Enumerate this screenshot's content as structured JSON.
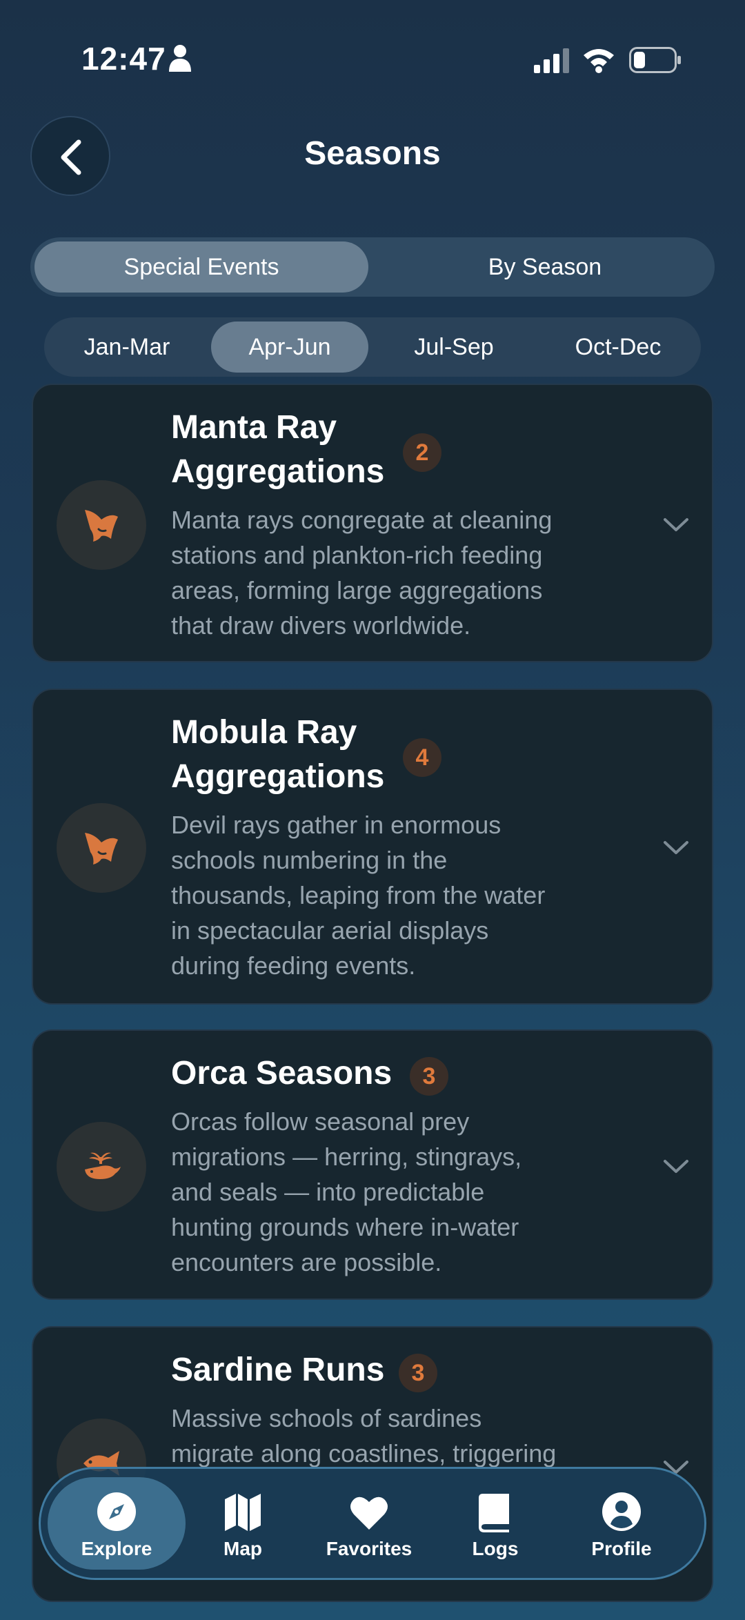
{
  "status_bar": {
    "time": "12:47"
  },
  "header": {
    "title": "Seasons"
  },
  "segments": [
    {
      "label": "Special Events",
      "active": true
    },
    {
      "label": "By Season",
      "active": false
    }
  ],
  "quarters": [
    {
      "label": "Jan-Mar",
      "active": false
    },
    {
      "label": "Apr-Jun",
      "active": true
    },
    {
      "label": "Jul-Sep",
      "active": false
    },
    {
      "label": "Oct-Dec",
      "active": false
    }
  ],
  "events": [
    {
      "title_lines": [
        "Manta Ray",
        "Aggregations"
      ],
      "count": "2",
      "icon": "manta-ray-icon",
      "description": [
        "Manta rays congregate at cleaning",
        "stations and plankton-rich feeding",
        "areas, forming large aggregations",
        "that draw divers worldwide."
      ]
    },
    {
      "title_lines": [
        "Mobula Ray",
        "Aggregations"
      ],
      "count": "4",
      "icon": "mobula-ray-icon",
      "description": [
        "Devil rays gather in enormous",
        "schools numbering in the",
        "thousands, leaping from the water",
        "in spectacular aerial displays",
        "during feeding events."
      ]
    },
    {
      "title_lines": [
        "Orca Seasons"
      ],
      "count": "3",
      "icon": "whale-icon",
      "description": [
        "Orcas follow seasonal prey",
        "migrations — herring, stingrays,",
        "and seals — into predictable",
        "hunting grounds where in-water",
        "encounters are possible."
      ]
    },
    {
      "title_lines": [
        "Sardine Runs"
      ],
      "count": "3",
      "icon": "fish-icon",
      "description": [
        "Massive schools of sardines",
        "migrate along coastlines, triggering"
      ]
    }
  ],
  "nav": [
    {
      "label": "Explore",
      "icon": "compass-icon",
      "active": true
    },
    {
      "label": "Map",
      "icon": "map-icon",
      "active": false
    },
    {
      "label": "Favorites",
      "icon": "heart-icon",
      "active": false
    },
    {
      "label": "Logs",
      "icon": "book-icon",
      "active": false
    },
    {
      "label": "Profile",
      "icon": "person-circle-icon",
      "active": false
    }
  ],
  "colors": {
    "accent": "#e07a3c",
    "card_bg": "#17262f",
    "nav_active": "#3c6e8e"
  }
}
